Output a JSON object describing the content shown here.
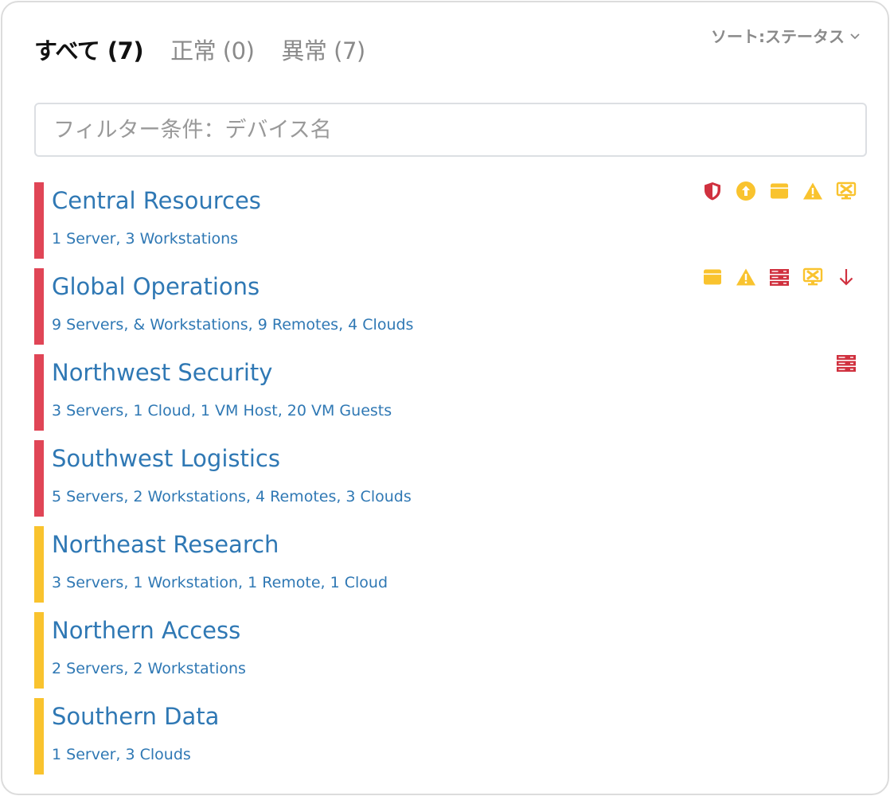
{
  "tabs": [
    {
      "label": "すべて (7)",
      "active": true
    },
    {
      "label": "正常 (0)",
      "active": false
    },
    {
      "label": "異常 (7)",
      "active": false
    }
  ],
  "sort": {
    "label": "ソート:ステータス",
    "icon": "chevron-down-icon"
  },
  "filter": {
    "placeholder": "フィルター条件：デバイス名",
    "value": ""
  },
  "colors": {
    "critical": "#e04556",
    "warning": "#f9c32e",
    "link": "#2f78b4"
  },
  "groups": [
    {
      "title": "Central Resources",
      "subtitle": "1 Server, 3 Workstations",
      "status": "critical",
      "icons": [
        "shield-icon",
        "upload-circle-icon",
        "window-icon",
        "warning-icon",
        "monitor-error-icon"
      ]
    },
    {
      "title": "Global Operations",
      "subtitle": "9 Servers, & Workstations, 9 Remotes, 4 Clouds",
      "status": "critical",
      "icons": [
        "window-icon",
        "warning-icon",
        "server-icon",
        "monitor-error-icon",
        "arrow-down-icon"
      ]
    },
    {
      "title": "Northwest Security",
      "subtitle": "3 Servers, 1 Cloud, 1 VM Host, 20 VM Guests",
      "status": "critical",
      "icons": [
        "server-icon"
      ]
    },
    {
      "title": "Southwest Logistics",
      "subtitle": "5 Servers, 2 Workstations, 4 Remotes, 3 Clouds",
      "status": "critical",
      "icons": []
    },
    {
      "title": "Northeast Research",
      "subtitle": "3 Servers, 1 Workstation, 1 Remote, 1 Cloud",
      "status": "warning",
      "icons": []
    },
    {
      "title": "Northern Access",
      "subtitle": "2 Servers, 2 Workstations",
      "status": "warning",
      "icons": []
    },
    {
      "title": "Southern Data",
      "subtitle": "1 Server, 3 Clouds",
      "status": "warning",
      "icons": []
    }
  ]
}
